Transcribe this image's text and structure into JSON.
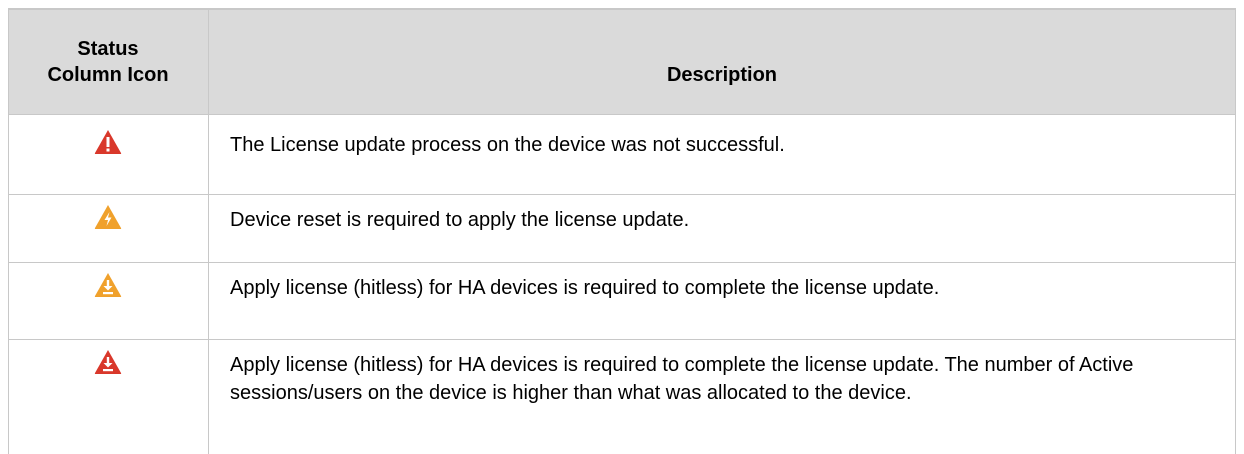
{
  "table": {
    "headers": {
      "status_icon": "Status\nColumn Icon",
      "description": "Description"
    },
    "rows": [
      {
        "icon": "red-exclamation-warning-icon",
        "icon_color": "#d9382b",
        "description": "The License update process on the device was not successful."
      },
      {
        "icon": "orange-lightning-warning-icon",
        "icon_color": "#f0a12c",
        "description": "Device reset is required to apply the license update."
      },
      {
        "icon": "orange-download-warning-icon",
        "icon_color": "#f0a12c",
        "description": "Apply license (hitless) for HA devices is required to complete the license update."
      },
      {
        "icon": "red-download-warning-icon",
        "icon_color": "#d9382b",
        "description": "Apply license (hitless) for HA devices is required to complete the license update. The number of Active sessions/users on the device is higher than what was allocated to the device."
      }
    ]
  },
  "colors": {
    "header_bg": "#dadada",
    "border": "#c8c8c8"
  }
}
